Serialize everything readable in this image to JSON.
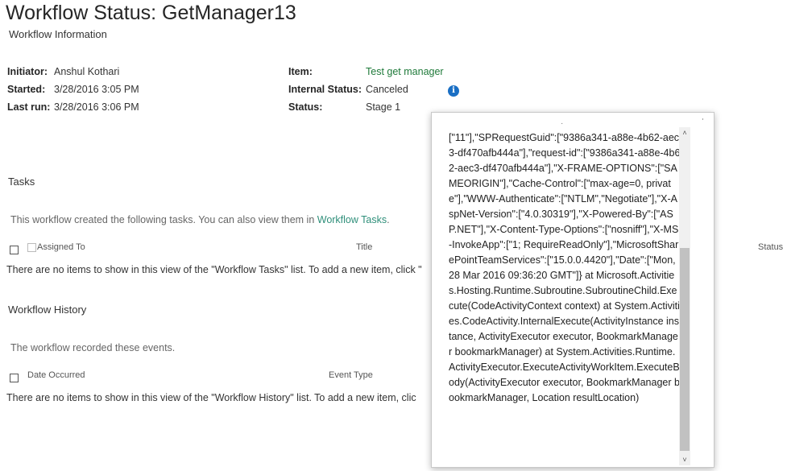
{
  "page": {
    "title": "Workflow Status: GetManager13"
  },
  "workflow_info": {
    "heading": "Workflow Information",
    "initiator_label": "Initiator:",
    "initiator_value": "Anshul Kothari",
    "started_label": "Started:",
    "started_value": "3/28/2016 3:05 PM",
    "last_run_label": "Last run:",
    "last_run_value": "3/28/2016 3:06 PM",
    "item_label": "Item:",
    "item_value": "Test get manager",
    "internal_status_label": "Internal Status:",
    "internal_status_value": "Canceled",
    "status_label": "Status:",
    "status_value": "Stage 1",
    "info_icon": "info-icon"
  },
  "tasks": {
    "heading": "Tasks",
    "description": "This workflow created the following tasks. You can also view them in ",
    "description_link": "Workflow Tasks",
    "description_end": ".",
    "columns": [
      "Assigned To",
      "Title",
      "Status"
    ],
    "empty_message": "There are no items to show in this view of the \"Workflow Tasks\" list. To add a new item, click \""
  },
  "history": {
    "heading": "Workflow History",
    "description": "The workflow recorded these events.",
    "columns": [
      "Date Occurred",
      "Event Type"
    ],
    "empty_message": "There are no items to show in this view of the \"Workflow History\" list. To add a new item, clic"
  },
  "popup": {
    "corner_mark": "˙",
    "top_dot": "·",
    "text": "[\"11\"],\"SPRequestGuid\":[\"9386a341-a88e-4b62-aec3-df470afb444a\"],\"request-id\":[\"9386a341-a88e-4b62-aec3-df470afb444a\"],\"X-FRAME-OPTIONS\":[\"SAMEORIGIN\"],\"Cache-Control\":[\"max-age=0, private\"],\"WWW-Authenticate\":[\"NTLM\",\"Negotiate\"],\"X-AspNet-Version\":[\"4.0.30319\"],\"X-Powered-By\":[\"ASP.NET\"],\"X-Content-Type-Options\":[\"nosniff\"],\"X-MS-InvokeApp\":[\"1; RequireReadOnly\"],\"MicrosoftSharePointTeamServices\":[\"15.0.0.4420\"],\"Date\":[\"Mon, 28 Mar 2016 09:36:20 GMT\"]} at Microsoft.Activities.Hosting.Runtime.Subroutine.SubroutineChild.Execute(CodeActivityContext context) at System.Activities.CodeActivity.InternalExecute(ActivityInstance instance, ActivityExecutor executor, BookmarkManager bookmarkManager) at System.Activities.Runtime.ActivityExecutor.ExecuteActivityWorkItem.ExecuteBody(ActivityExecutor executor, BookmarkManager bookmarkManager, Location resultLocation)",
    "scroll_up": "˄",
    "scroll_down": "˅"
  },
  "colors": {
    "link_green": "#1f7a3a",
    "link_teal": "#2f8f7a",
    "info_blue": "#1a6fc4"
  }
}
